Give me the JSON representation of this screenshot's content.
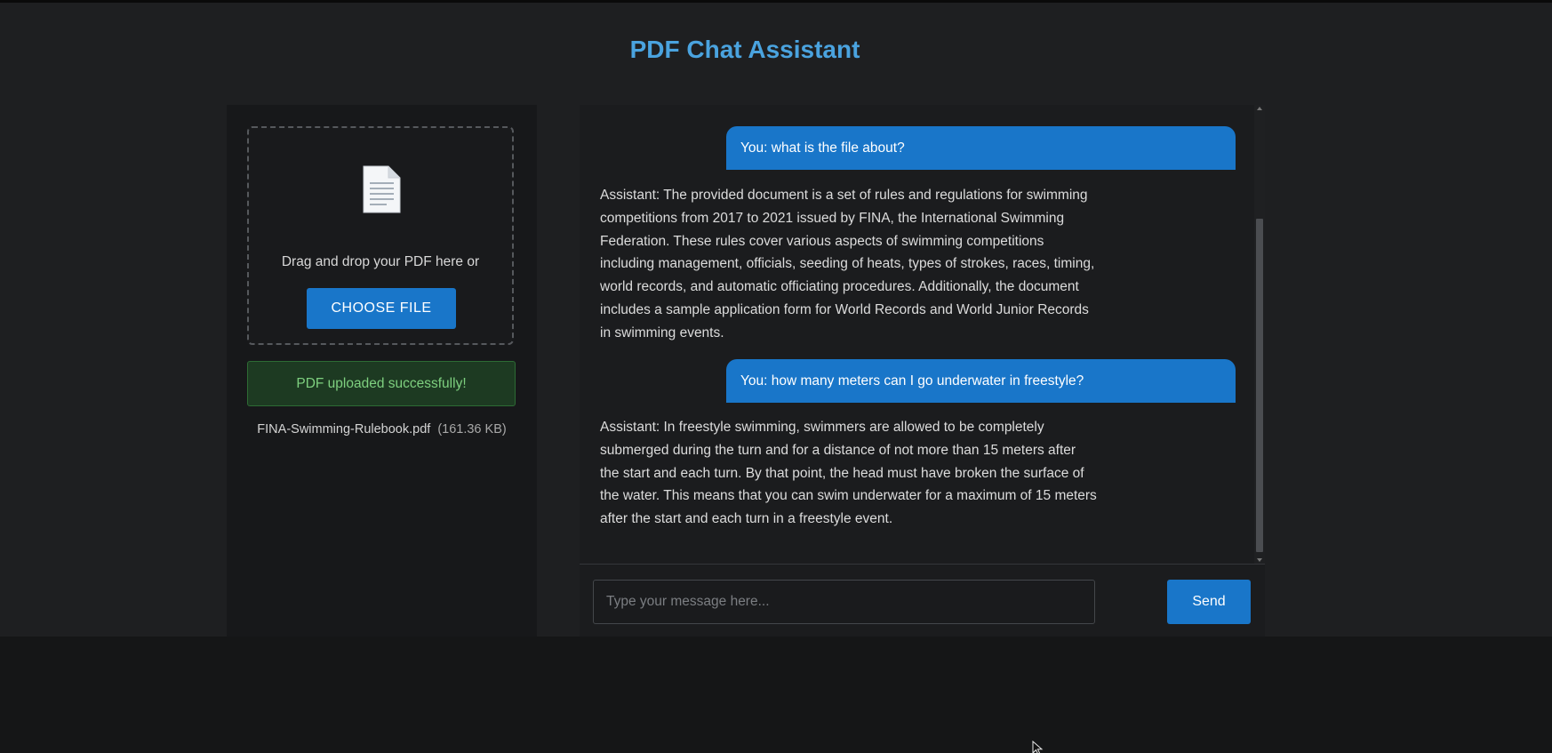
{
  "header": {
    "title": "PDF Chat Assistant"
  },
  "upload": {
    "icon": "document-icon",
    "drop_text": "Drag and drop your PDF here or",
    "choose_label": "CHOOSE FILE",
    "status_message": "PDF uploaded successfully!",
    "file_name": "FINA-Swimming-Rulebook.pdf",
    "file_size": "(161.36 KB)"
  },
  "chat": {
    "messages": [
      {
        "role": "user",
        "text": "You: what is the file about?"
      },
      {
        "role": "assistant",
        "text": "Assistant: The provided document is a set of rules and regulations for swimming competitions from 2017 to 2021 issued by FINA, the International Swimming Federation. These rules cover various aspects of swimming competitions including management, officials, seeding of heats, types of strokes, races, timing, world records, and automatic officiating procedures. Additionally, the document includes a sample application form for World Records and World Junior Records in swimming events."
      },
      {
        "role": "user",
        "text": "You: how many meters can I go underwater in freestyle?"
      },
      {
        "role": "assistant",
        "text": "Assistant: In freestyle swimming, swimmers are allowed to be completely submerged during the turn and for a distance of not more than 15 meters after the start and each turn. By that point, the head must have broken the surface of the water. This means that you can swim underwater for a maximum of 15 meters after the start and each turn in a freestyle event."
      }
    ],
    "input_placeholder": "Type your message here...",
    "input_value": "",
    "send_label": "Send"
  },
  "colors": {
    "accent": "#1976c9",
    "title": "#4aa3df",
    "success_text": "#7ed07f",
    "success_bg": "#1d3a22",
    "background": "#1e1f21"
  }
}
